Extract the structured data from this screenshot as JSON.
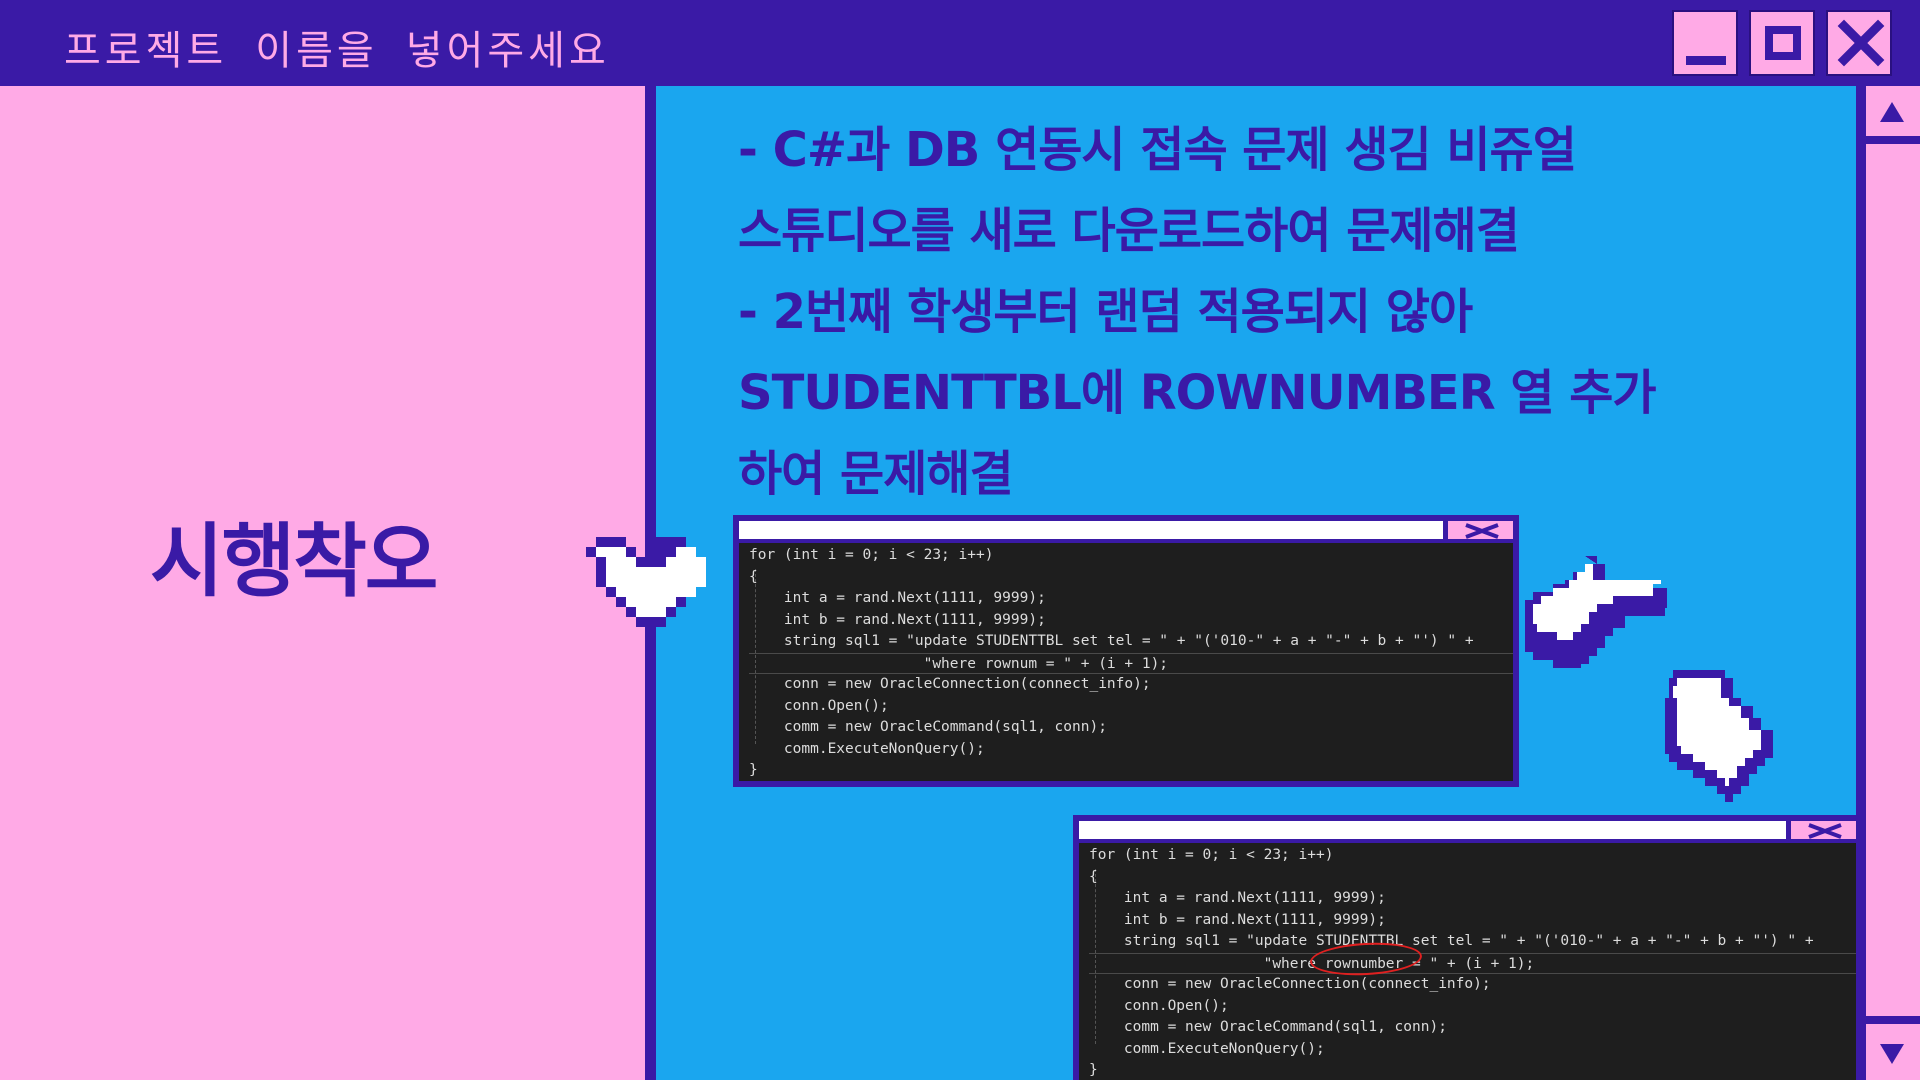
{
  "window": {
    "title": "프로젝트 이름을 넣어주세요",
    "buttons": {
      "minimize": "minimize",
      "maximize": "maximize",
      "close": "close"
    }
  },
  "left_panel": {
    "heading": "시행착오"
  },
  "content": {
    "lines": [
      "- C#과 DB 연동시 접속 문제 생김 비쥬얼",
      "스튜디오를 새로 다운로드하여 문제해결",
      "- 2번째 학생부터 랜덤 적용되지 않아",
      "STUDENTTBL에 ROWNUMBER 열 추가",
      "하여 문제해결"
    ]
  },
  "code_window_1": {
    "lines": [
      "for (int i = 0; i < 23; i++)",
      "{",
      "    int a = rand.Next(1111, 9999);",
      "    int b = rand.Next(1111, 9999);",
      "    string sql1 = \"update STUDENTTBL set tel = \" + \"('010-\" + a + \"-\" + b + \"') \" +",
      "                    \"where rownum = \" + (i + 1);",
      "    conn = new OracleConnection(connect_info);",
      "    conn.Open();",
      "    comm = new OracleCommand(sql1, conn);",
      "    comm.ExecuteNonQuery();",
      "}"
    ]
  },
  "code_window_2": {
    "lines": [
      "for (int i = 0; i < 23; i++)",
      "{",
      "    int a = rand.Next(1111, 9999);",
      "    int b = rand.Next(1111, 9999);",
      "    string sql1 = \"update STUDENTTBL set tel = \" + \"('010-\" + a + \"-\" + b + \"') \" +",
      "                    \"where rownumber = \" + (i + 1);",
      "    conn = new OracleConnection(connect_info);",
      "    conn.Open();",
      "    comm = new OracleCommand(sql1, conn);",
      "    comm.ExecuteNonQuery();",
      "}"
    ]
  },
  "colors": {
    "purple": "#3a1aa6",
    "pink": "#ffaae6",
    "blue": "#1aa6ef",
    "code_bg": "#1e1e1e"
  },
  "icons": [
    "heart-icon",
    "pointing-hand-right-icon",
    "pointing-hand-down-icon",
    "close-icon",
    "minimize-icon",
    "maximize-icon"
  ]
}
